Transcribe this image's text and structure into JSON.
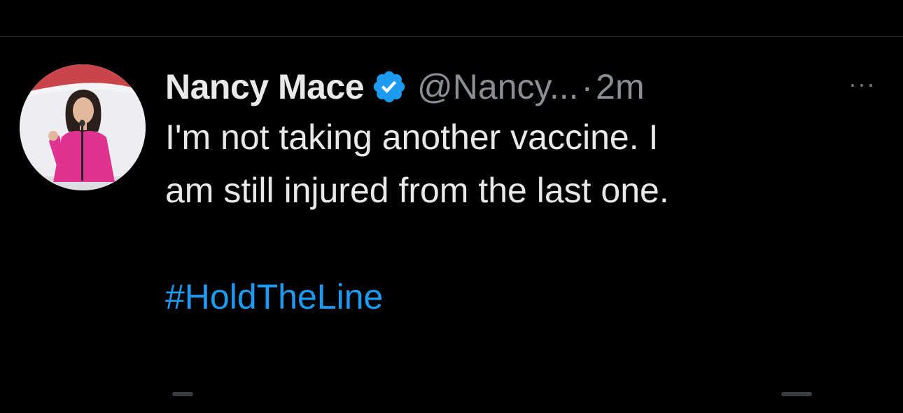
{
  "tweet": {
    "author": {
      "display_name": "Nancy Mace",
      "verified_icon": "verified-badge-icon",
      "handle": "@Nancy...",
      "separator": "·",
      "timestamp": "2m"
    },
    "more_menu_icon": "more-horizontal-icon",
    "more_label": "···",
    "text_lines": [
      "I'm not taking another vaccine. I",
      "am still injured from the last one."
    ],
    "hashtag": "#HoldTheLine"
  },
  "colors": {
    "background": "#000000",
    "primary_text": "#e7e9ea",
    "secondary_text": "#8b8f94",
    "link": "#1d9bf0",
    "verified": "#1d9bf0"
  }
}
